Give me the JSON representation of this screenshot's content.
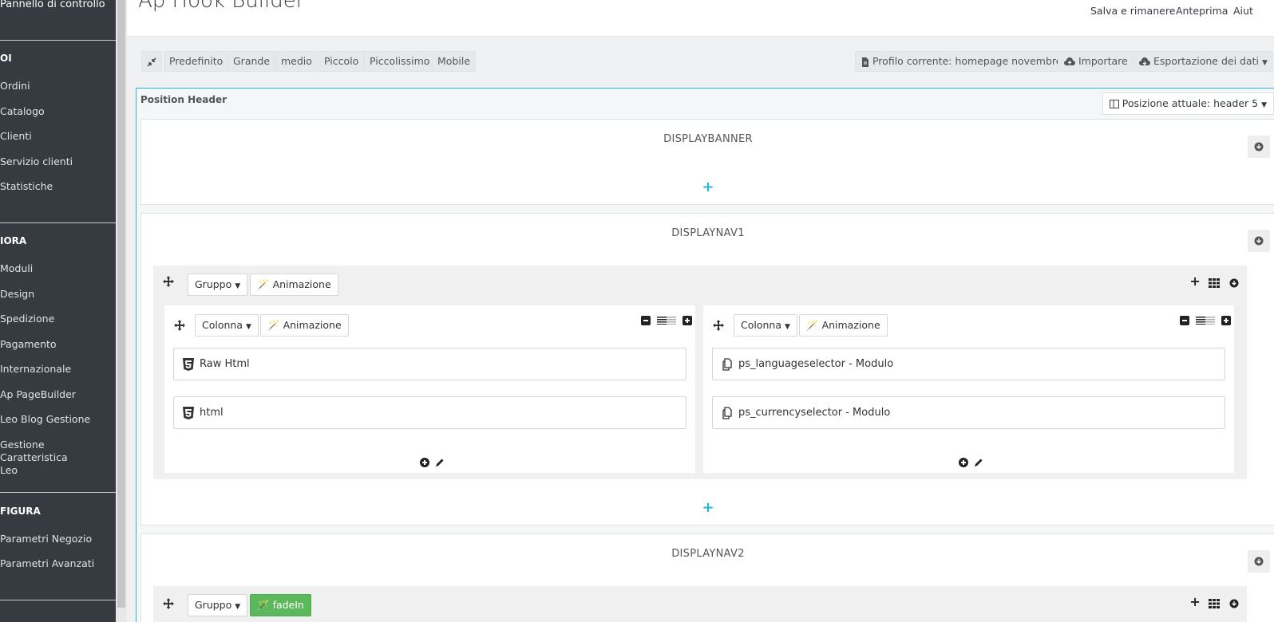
{
  "sidebar": {
    "top_item": "Pannello di controllo",
    "sections": [
      {
        "title": "OI",
        "items": [
          "Ordini",
          "Catalogo",
          "Clienti",
          "Servizio clienti",
          "Statistiche"
        ]
      },
      {
        "title": "IORA",
        "items": [
          "Moduli",
          "Design",
          "Spedizione",
          "Pagamento",
          "Internazionale",
          "Ap PageBuilder",
          "Leo Blog Gestione",
          "Gestione Caratteristica Leo"
        ]
      },
      {
        "title": "FIGURA",
        "items": [
          "Parametri Negozio",
          "Parametri Avanzati"
        ]
      }
    ]
  },
  "header": {
    "title": "Ap Hook Builder",
    "links": [
      "Salva e rimanere",
      "Anteprima",
      "Aiut"
    ]
  },
  "toolbar": {
    "left_buttons": [
      "Predefinito",
      "Grande",
      "medio",
      "Piccolo",
      "Piccolissimo",
      "Mobile"
    ],
    "profile_label": "Profilo corrente: homepage novembre",
    "import_label": "Importare",
    "export_label": "Esportazione dei dati"
  },
  "position": {
    "label": "Position Header",
    "current_label": "Posizione attuale: header 5"
  },
  "hooks": {
    "banner": {
      "title": "DISPLAYBANNER"
    },
    "nav1": {
      "title": "DISPLAYNAV1",
      "group_label": "Gruppo",
      "animation_label": "Animazione",
      "columns": [
        {
          "label": "Colonna",
          "animation_label": "Animazione",
          "modules": [
            "Raw Html",
            "html"
          ]
        },
        {
          "label": "Colonna",
          "animation_label": "Animazione",
          "modules": [
            "ps_languageselector - Modulo",
            "ps_currencyselector - Modulo"
          ]
        }
      ]
    },
    "nav2": {
      "title": "DISPLAYNAV2",
      "group_label": "Gruppo",
      "animation_label": "fadeIn"
    }
  },
  "colors": {
    "sidebar_bg": "#363a41",
    "accent": "#25b9d7",
    "fadein_green": "#5cb85c"
  }
}
